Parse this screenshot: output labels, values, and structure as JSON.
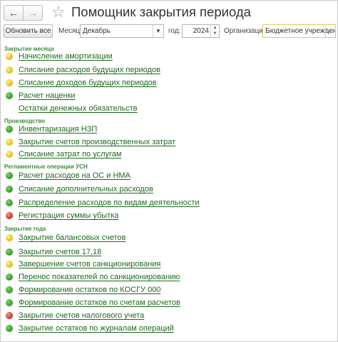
{
  "title": "Помощник закрытия периода",
  "nav": {
    "back_icon": "←",
    "forward_icon": "→",
    "favorite_icon": "☆"
  },
  "toolbar": {
    "refresh_label": "Обновить все",
    "month_label": "Месяц:",
    "month_value": "Декабрь",
    "year_label": "год:",
    "year_value": "2024",
    "org_label": "Организация:",
    "org_value": "Бюджетное учреждение"
  },
  "status_colors": {
    "yellow": "#e6c21a",
    "green": "#3d9e2e",
    "red": "#cf3b2b"
  },
  "sections": [
    {
      "title": "Закрытие месяца",
      "items": [
        {
          "label": "Начисление амортизации",
          "status": "yellow"
        },
        {
          "label": "Списание расходов будущих периодов",
          "status": "yellow"
        },
        {
          "label": "Списание доходов будущих периодов",
          "status": "yellow"
        },
        {
          "label": "Расчет наценки",
          "status": "green"
        },
        {
          "label": "Остатки денежных обязательств",
          "status": "none"
        }
      ]
    },
    {
      "title": "Производство",
      "items": [
        {
          "label": "Инвентаризация НЗП",
          "status": "green"
        },
        {
          "label": "Закрытие счетов производственных затрат",
          "status": "yellow"
        },
        {
          "label": "Списание затрат по услугам",
          "status": "yellow"
        }
      ]
    },
    {
      "title": "Регламентные операции УСН",
      "items": [
        {
          "label": "Расчет расходов на ОС и НМА",
          "status": "green"
        },
        {
          "label": "Списание дополнительных расходов",
          "status": "green"
        },
        {
          "label": "Распределение расходов по видам деятельности",
          "status": "green"
        },
        {
          "label": "Регистрация суммы убытка",
          "status": "red"
        }
      ]
    },
    {
      "title": "Закрытие года",
      "items": [
        {
          "label": "Закрытие балансовых счетов",
          "status": "yellow"
        },
        {
          "label": "Закрытие  счетов 17,18",
          "status": "green"
        },
        {
          "label": "Завершение счетов санкционирования",
          "status": "yellow"
        },
        {
          "label": "Перенос показателей по санкционированию",
          "status": "green"
        },
        {
          "label": "Формирование остатков по КОСГУ 000",
          "status": "green"
        },
        {
          "label": "Формирование остатков по счетам расчетов",
          "status": "green"
        },
        {
          "label": "Закрытие счетов налогового учета",
          "status": "red"
        },
        {
          "label": "Закрытие остатков по журналам операций",
          "status": "green"
        }
      ]
    }
  ]
}
